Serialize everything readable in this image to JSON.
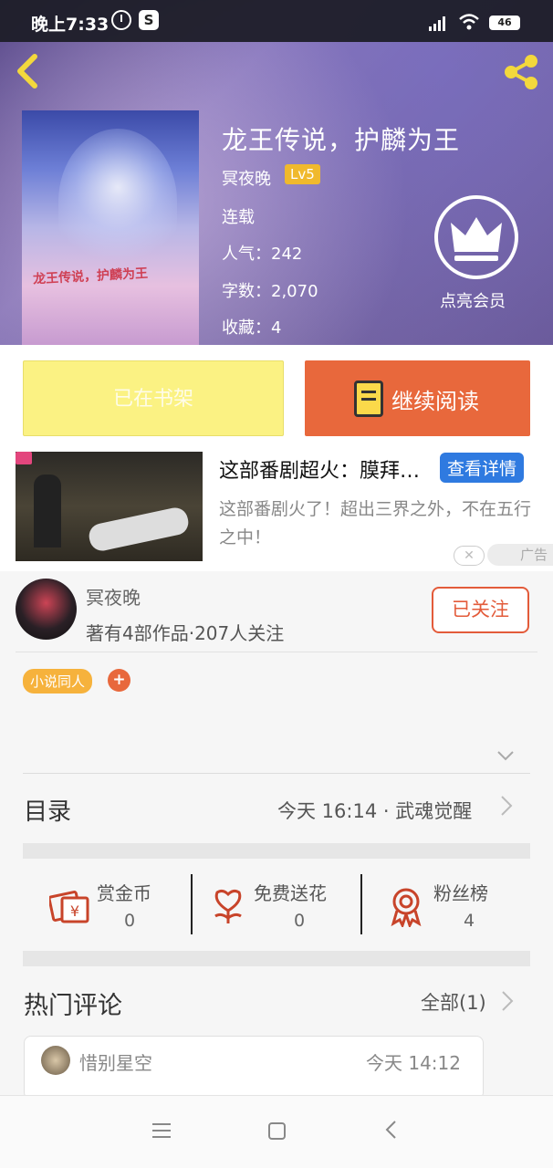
{
  "status_bar": {
    "time": "晚上7:33",
    "battery": "46",
    "app_badge": "S"
  },
  "book": {
    "title": "龙王传说，护麟为王",
    "author": "冥夜晚",
    "level": "Lv5",
    "status": "连载",
    "popularity": "人气：242",
    "word_count": "字数：2,070",
    "favorites": "收藏：4",
    "cover_text": "龙王传说，护麟为王"
  },
  "vip": {
    "label": "点亮会员"
  },
  "actions": {
    "shelf_label": "已在书架",
    "read_label": "继续阅读"
  },
  "ad": {
    "headline": "这部番剧超火：膜拜…",
    "detail_label": "查看详情",
    "description": "这部番剧火了！超出三界之外，不在五行之中！",
    "close_symbol": "✕",
    "tag": "广告"
  },
  "author_card": {
    "name": "冥夜晚",
    "stats": "著有4部作品·207人关注",
    "follow_label": "已关注"
  },
  "tags": {
    "items": [
      "小说同人"
    ],
    "add_symbol": "+"
  },
  "toc": {
    "label": "目录",
    "latest": "今天 16:14 · 武魂觉醒"
  },
  "stats": [
    {
      "label": "赏金币",
      "value": "0"
    },
    {
      "label": "免费送花",
      "value": "0"
    },
    {
      "label": "粉丝榜",
      "value": "4"
    }
  ],
  "comments": {
    "label": "热门评论",
    "all_label": "全部(1)",
    "items": [
      {
        "user": "惜别星空",
        "time": "今天 14:12"
      }
    ]
  },
  "colors": {
    "accent": "#e8683c",
    "shelf": "#fbf283",
    "badge": "#f0b92d",
    "ad_button": "#2f7ae0"
  }
}
